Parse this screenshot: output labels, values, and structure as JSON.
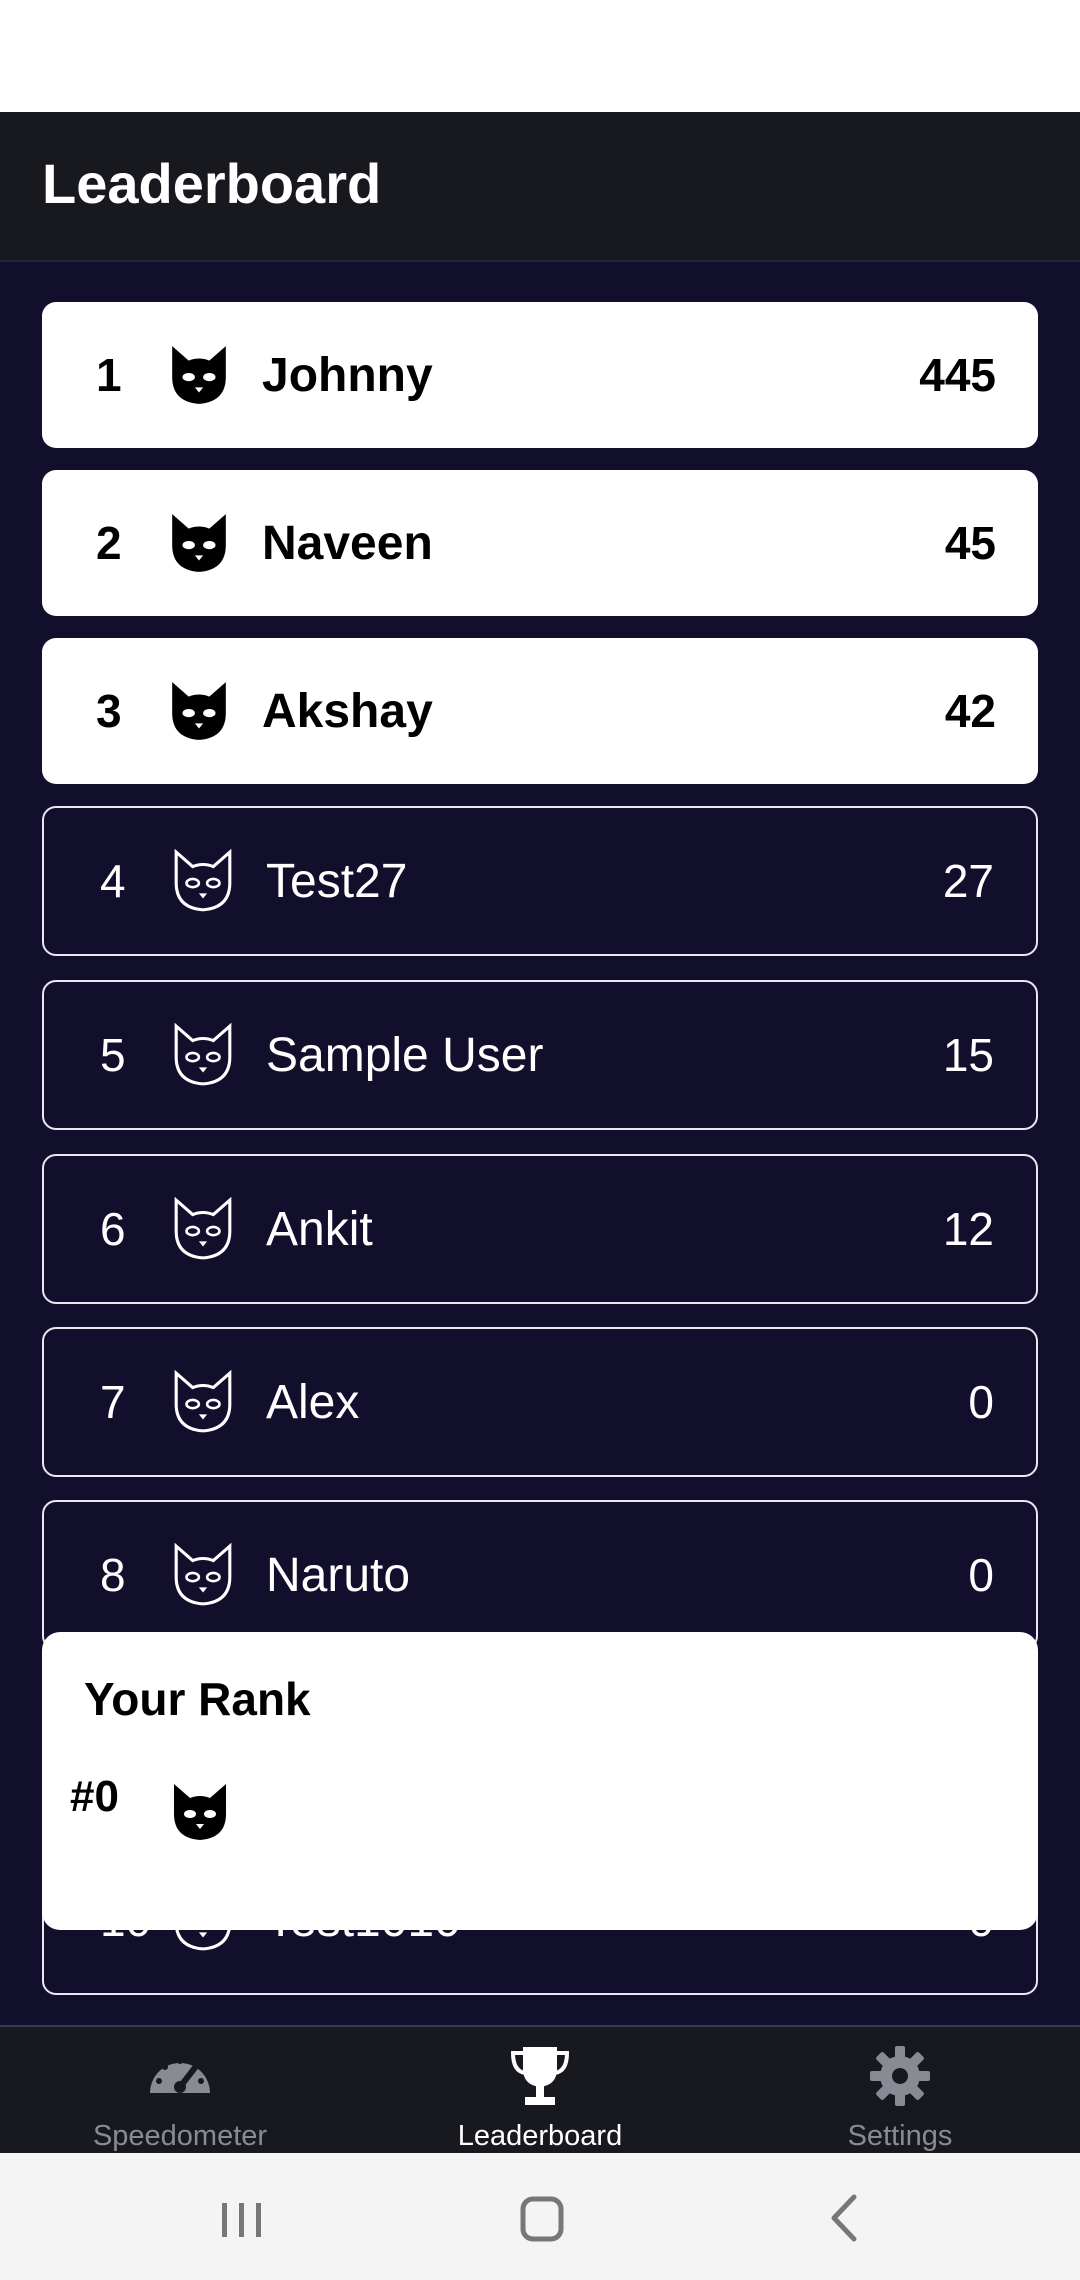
{
  "app": {
    "title": "Leaderboard"
  },
  "leaderboard": {
    "rows": [
      {
        "rank": "1",
        "name": "Johnny",
        "score": "445",
        "avatar": "cat-icon"
      },
      {
        "rank": "2",
        "name": "Naveen",
        "score": "45",
        "avatar": "cat-icon"
      },
      {
        "rank": "3",
        "name": "Akshay",
        "score": "42",
        "avatar": "cat-icon"
      },
      {
        "rank": "4",
        "name": "Test27",
        "score": "27",
        "avatar": "cat-outline-icon"
      },
      {
        "rank": "5",
        "name": "Sample User",
        "score": "15",
        "avatar": "cat-outline-icon"
      },
      {
        "rank": "6",
        "name": "Ankit",
        "score": "12",
        "avatar": "cat-outline-icon"
      },
      {
        "rank": "7",
        "name": "Alex",
        "score": "0",
        "avatar": "cat-outline-icon"
      },
      {
        "rank": "8",
        "name": "Naruto",
        "score": "0",
        "avatar": "cat-outline-icon"
      },
      {
        "rank": "10",
        "name": "Test1010",
        "score": "0",
        "avatar": "cat-outline-icon"
      }
    ]
  },
  "your_rank": {
    "title": "Your Rank",
    "rank": "#0",
    "avatar": "cat-icon"
  },
  "bottom_nav": {
    "items": [
      {
        "label": "Speedometer",
        "icon": "speedometer-icon",
        "active": false
      },
      {
        "label": "Leaderboard",
        "icon": "trophy-icon",
        "active": true
      },
      {
        "label": "Settings",
        "icon": "gear-icon",
        "active": false
      }
    ]
  },
  "colors": {
    "background": "#120f2c",
    "app_bar": "#18181f",
    "nav_active": "#ffffff",
    "nav_inactive": "#8a8a95"
  }
}
